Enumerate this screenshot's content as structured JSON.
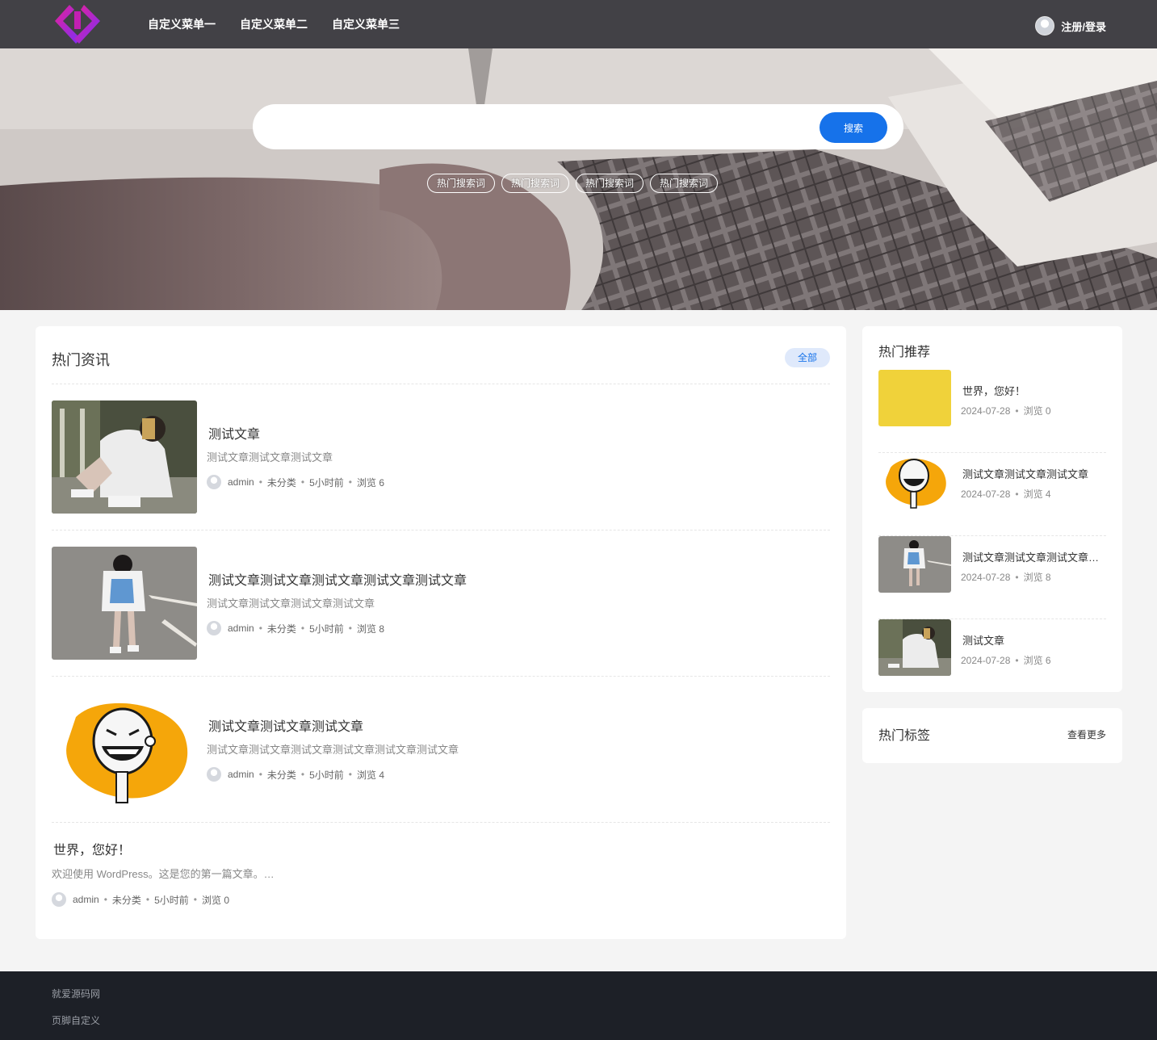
{
  "header": {
    "logo": "logo-icon",
    "nav": [
      "自定义菜单一",
      "自定义菜单二",
      "自定义菜单三"
    ],
    "login": "注册/登录"
  },
  "hero": {
    "search_placeholder": "",
    "search_button": "搜索",
    "hot_words": [
      "热门搜索词",
      "热门搜索词",
      "热门搜索词",
      "热门搜索词"
    ]
  },
  "main": {
    "title": "热门资讯",
    "all_button": "全部",
    "posts": [
      {
        "title": "测试文章",
        "excerpt": "测试文章测试文章测试文章",
        "author": "admin",
        "category": "未分类",
        "time": "5小时前",
        "views": "浏览 6"
      },
      {
        "title": "测试文章测试文章测试文章测试文章测试文章",
        "excerpt": "测试文章测试文章测试文章测试文章",
        "author": "admin",
        "category": "未分类",
        "time": "5小时前",
        "views": "浏览 8"
      },
      {
        "title": "测试文章测试文章测试文章",
        "excerpt": "测试文章测试文章测试文章测试文章测试文章测试文章",
        "author": "admin",
        "category": "未分类",
        "time": "5小时前",
        "views": "浏览 4"
      },
      {
        "title": "世界，您好！",
        "excerpt": "欢迎使用 WordPress。这是您的第一篇文章。…",
        "author": "admin",
        "category": "未分类",
        "time": "5小时前",
        "views": "浏览 0"
      }
    ]
  },
  "sidebar": {
    "recommend_title": "热门推荐",
    "recommend": [
      {
        "title": "世界，您好！",
        "date": "2024-07-28",
        "views": "浏览 0"
      },
      {
        "title": "测试文章测试文章测试文章",
        "date": "2024-07-28",
        "views": "浏览 4"
      },
      {
        "title": "测试文章测试文章测试文章测试文章测试文章",
        "date": "2024-07-28",
        "views": "浏览 8"
      },
      {
        "title": "测试文章",
        "date": "2024-07-28",
        "views": "浏览 6"
      }
    ],
    "tags_title": "热门标签",
    "tags_more": "查看更多"
  },
  "footer": {
    "line1": "就爱源码网",
    "line2": "页脚自定义"
  },
  "colors": {
    "accent": "#1672ea",
    "header_bg": "#34343a",
    "footer_bg": "#1d2027",
    "placeholder_yellow": "#f0d23a"
  }
}
